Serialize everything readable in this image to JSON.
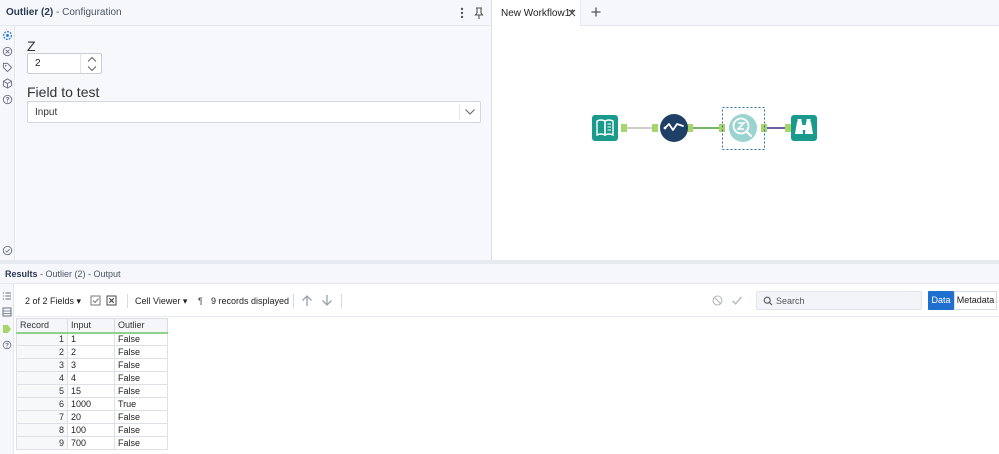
{
  "config": {
    "title_bold": "Outlier (2)",
    "title_rest": " - Configuration",
    "z_label": "Z",
    "z_value": "2",
    "field_label": "Field to test",
    "field_value": "Input"
  },
  "workflow": {
    "tab_label": "New Workflow1*",
    "tools": [
      "input-data-tool",
      "data-cleansing-tool",
      "outlier-tool",
      "browse-tool"
    ],
    "colors": {
      "teal": "#1a9a8c",
      "navy": "#1e3f66",
      "zscore": "#9ad3cf",
      "connector": "#a6d66b"
    }
  },
  "results": {
    "title_bold": "Results",
    "title_rest": " - Outlier (2) - Output",
    "fields_label": "2 of 2 Fields",
    "cell_viewer_label": "Cell Viewer",
    "records_label": "9 records displayed",
    "search_placeholder": "Search",
    "data_button": "Data",
    "metadata_button": "Metadata",
    "columns": [
      "Record",
      "Input",
      "Outlier"
    ],
    "rows": [
      [
        "1",
        "1",
        "False"
      ],
      [
        "2",
        "2",
        "False"
      ],
      [
        "3",
        "3",
        "False"
      ],
      [
        "4",
        "4",
        "False"
      ],
      [
        "5",
        "15",
        "False"
      ],
      [
        "6",
        "1000",
        "True"
      ],
      [
        "7",
        "20",
        "False"
      ],
      [
        "8",
        "100",
        "False"
      ],
      [
        "9",
        "700",
        "False"
      ]
    ]
  }
}
